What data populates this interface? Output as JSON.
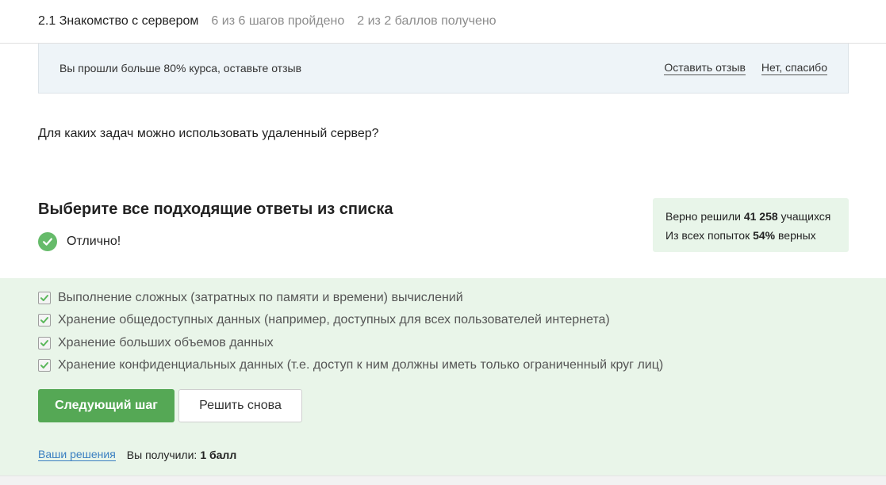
{
  "header": {
    "lesson_title": "2.1 Знакомство с сервером",
    "steps_progress": "6 из 6 шагов пройдено",
    "points_progress": "2 из 2 баллов  получено"
  },
  "review_banner": {
    "message": "Вы прошли больше 80% курса, оставьте отзыв",
    "leave_review": "Оставить отзыв",
    "no_thanks": "Нет, спасибо"
  },
  "question": {
    "text": "Для каких задач можно использовать удаленный сервер?"
  },
  "task": {
    "title": "Выберите все подходящие ответы из списка",
    "verdict": "Отлично!",
    "success_color": "#66bb6a"
  },
  "stats": {
    "solved_prefix": "Верно решили ",
    "solved_count": "41 258",
    "solved_suffix": " учащихся",
    "attempts_prefix": "Из всех попыток ",
    "attempts_percent": "54%",
    "attempts_suffix": " верных"
  },
  "options": [
    {
      "label": "Выполнение сложных (затратных по памяти и времени) вычислений",
      "checked": true
    },
    {
      "label": "Хранение общедоступных данных (например, доступных для всех пользователей интернета)",
      "checked": true
    },
    {
      "label": "Хранение больших объемов данных",
      "checked": true
    },
    {
      "label": "Хранение конфиденциальных данных (т.е. доступ к ним должны иметь только ограниченный круг лиц)",
      "checked": true
    }
  ],
  "actions": {
    "next_step": "Следующий шаг",
    "solve_again": "Решить снова",
    "primary_color": "#55a855"
  },
  "footer": {
    "your_solutions": "Ваши решения",
    "you_got": "Вы получили:",
    "points": "1 балл"
  },
  "icons": {
    "verdict": "check-circle-icon",
    "option": "checkbox-checked-icon"
  }
}
